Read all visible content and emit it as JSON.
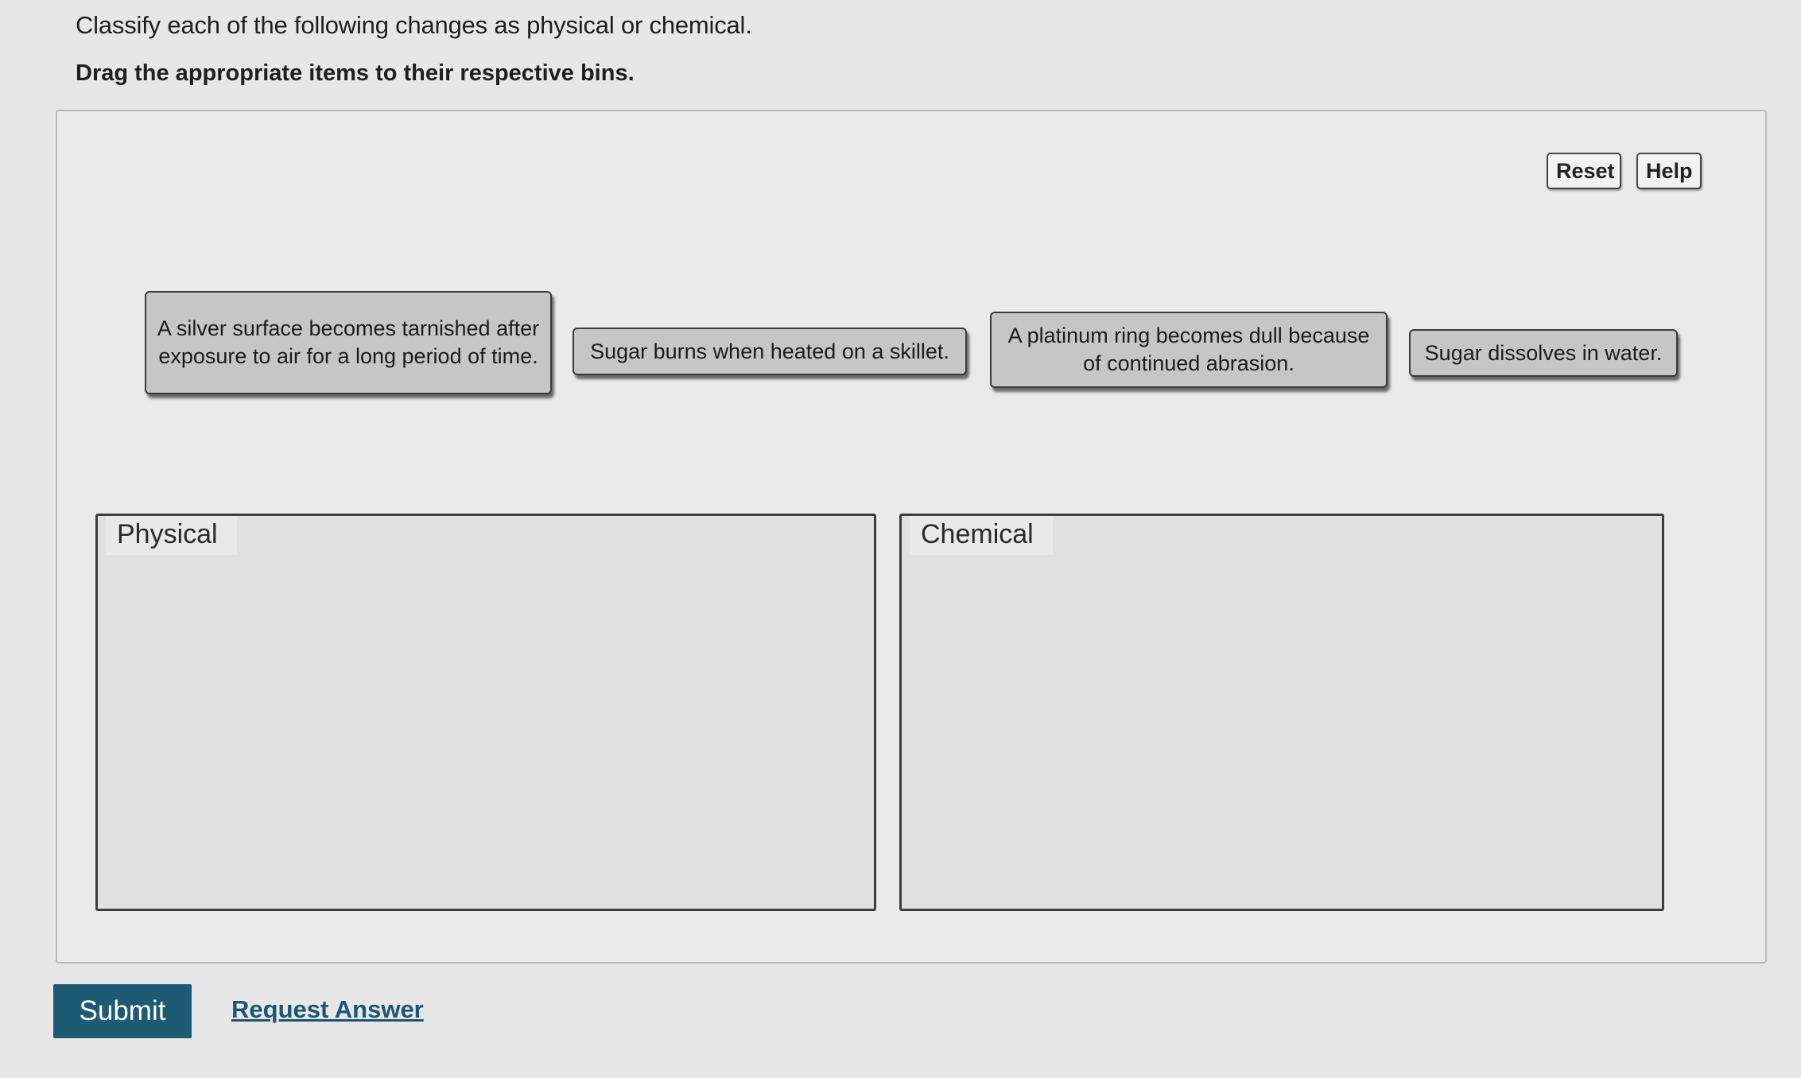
{
  "instruction": "Classify each of the following changes as physical or chemical.",
  "subinstruction": "Drag the appropriate items to their respective bins.",
  "toolbar": {
    "reset_label": "Reset",
    "help_label": "Help"
  },
  "items": [
    {
      "label": "A silver surface becomes tarnished after exposure to air for a long period of time."
    },
    {
      "label": "Sugar burns when heated on a skillet."
    },
    {
      "label": "A platinum ring becomes dull because of continued abrasion."
    },
    {
      "label": "Sugar dissolves in water."
    }
  ],
  "bins": [
    {
      "label": "Physical"
    },
    {
      "label": "Chemical"
    }
  ],
  "actions": {
    "submit_label": "Submit",
    "request_answer_label": "Request Answer"
  },
  "colors": {
    "submit_bg": "#1d5b73",
    "link": "#1d5673"
  }
}
